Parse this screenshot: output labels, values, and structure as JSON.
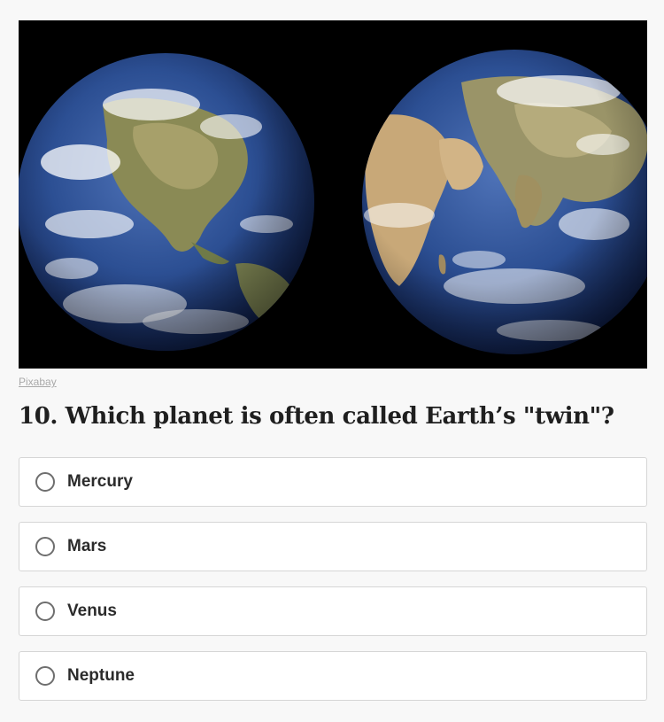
{
  "image": {
    "credit_text": "Pixabay",
    "background_color": "#000000",
    "ocean_color": "#2b4d8f",
    "land_color": "#a39a6a",
    "cloud_color": "#ffffff"
  },
  "question": {
    "text": "10. Which planet is often called Earth’s \"twin\"?"
  },
  "options": [
    {
      "label": "Mercury",
      "selected": false
    },
    {
      "label": "Mars",
      "selected": false
    },
    {
      "label": "Venus",
      "selected": false
    },
    {
      "label": "Neptune",
      "selected": false
    }
  ]
}
